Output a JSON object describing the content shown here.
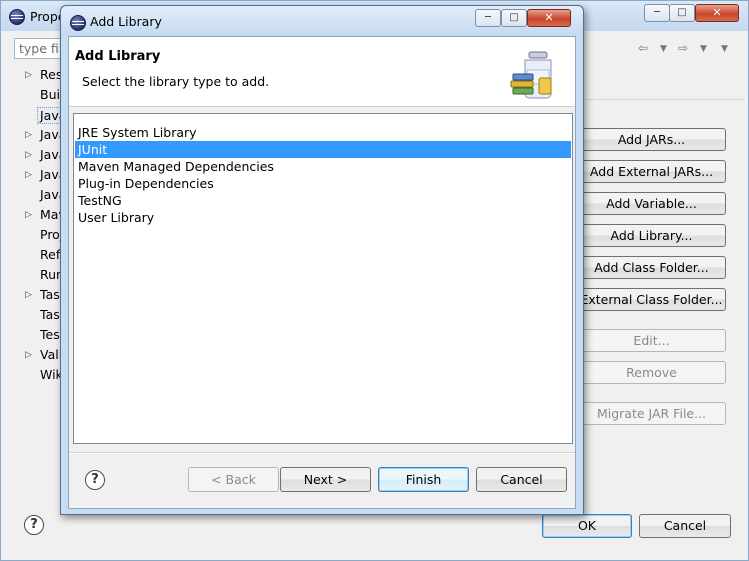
{
  "background_window": {
    "title": "Prope",
    "search_placeholder": "type filt",
    "tree_items": [
      "Res",
      "Buil",
      "Java",
      "Java",
      "Java",
      "Java",
      "Java",
      "Mav",
      "Proj",
      "Refa",
      "Run",
      "Tas",
      "Tas",
      "Test",
      "Vali",
      "Wik"
    ],
    "side_buttons": [
      {
        "label": "Add JARs...",
        "enabled": true
      },
      {
        "label": "Add External JARs...",
        "enabled": true
      },
      {
        "label": "Add Variable...",
        "enabled": true
      },
      {
        "label": "Add Library...",
        "enabled": true
      },
      {
        "label": "Add Class Folder...",
        "enabled": true
      },
      {
        "label": "External Class Folder...",
        "enabled": true
      },
      {
        "label": "Edit...",
        "enabled": false
      },
      {
        "label": "Remove",
        "enabled": false
      },
      {
        "label": "Migrate JAR File...",
        "enabled": false
      }
    ],
    "ok_label": "OK",
    "cancel_label": "Cancel"
  },
  "dialog": {
    "title": "Add Library",
    "header_title": "Add Library",
    "header_description": "Select the library type to add.",
    "library_types": [
      {
        "label": "JRE System Library",
        "selected": false
      },
      {
        "label": "JUnit",
        "selected": true
      },
      {
        "label": "Maven Managed Dependencies",
        "selected": false
      },
      {
        "label": "Plug-in Dependencies",
        "selected": false
      },
      {
        "label": "TestNG",
        "selected": false
      },
      {
        "label": "User Library",
        "selected": false
      }
    ],
    "back_label": "< Back",
    "next_label": "Next >",
    "finish_label": "Finish",
    "cancel_label": "Cancel"
  },
  "icons": {
    "help": "?",
    "minimize": "─",
    "maximize": "□",
    "close": "✕"
  },
  "colors": {
    "selection": "#3399ff",
    "title_bar": "#c8dcf2"
  }
}
